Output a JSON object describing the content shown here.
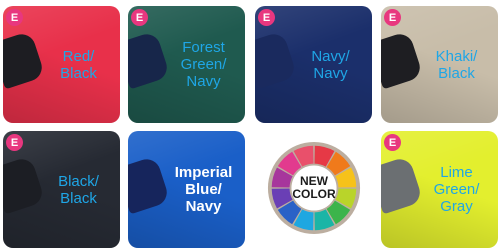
{
  "badge_letter": "E",
  "tiles": [
    {
      "label": "Red/\nBlack",
      "fabric": "#e8304a",
      "collar": "#1d1d22",
      "badge": true,
      "label_style": "blue"
    },
    {
      "label": "Forest\nGreen/\nNavy",
      "fabric": "#1f5a4f",
      "collar": "#17264a",
      "badge": true,
      "label_style": "blue"
    },
    {
      "label": "Navy/\nNavy",
      "fabric": "#1b2f6b",
      "collar": "#1a2a5e",
      "badge": true,
      "label_style": "blue"
    },
    {
      "label": "Khaki/\nBlack",
      "fabric": "#c8bda9",
      "collar": "#1e1e22",
      "badge": true,
      "label_style": "blue"
    },
    {
      "label": "Black/\nBlack",
      "fabric": "#262a33",
      "collar": "#1c1e24",
      "badge": true,
      "label_style": "blue"
    },
    {
      "label": "Imperial\nBlue/\nNavy",
      "fabric": "#1a5fc8",
      "collar": "#16255c",
      "badge": false,
      "label_style": "white"
    },
    {
      "label": "NEW\nCOLOR",
      "type": "wheel",
      "badge": false
    },
    {
      "label": "Lime\nGreen/\nGray",
      "fabric": "#e3ef2e",
      "collar": "#6b6f72",
      "badge": true,
      "label_style": "blue"
    }
  ],
  "wheel_colors": [
    "#e63946",
    "#f07a1b",
    "#f6c21a",
    "#b9d42a",
    "#3cb44b",
    "#1bb5a6",
    "#1ea7e1",
    "#2a62c7",
    "#6a3fb5",
    "#a7369c",
    "#e23a8e",
    "#e9506b"
  ],
  "wheel_ring": "#bcaea0"
}
